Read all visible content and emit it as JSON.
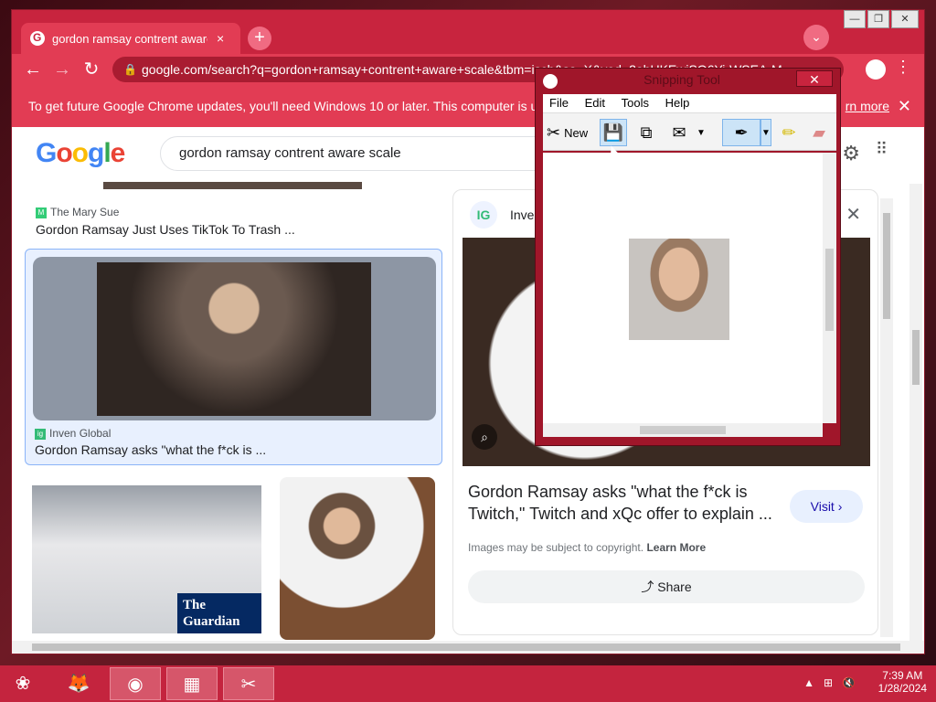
{
  "browser": {
    "tab_title": "gordon ramsay contrent aware sc",
    "tab_close": "×",
    "new_tab": "+",
    "url": "google.com/search?q=gordon+ramsay+contrent+aware+scale&tbm=isch&sa=X&ved=2ahUKEwjSQ6Yi-WSEA-M...",
    "infobar_text": "To get future Google Chrome updates, you'll need Windows 10 or later. This computer is using W",
    "infobar_link": "rn more",
    "infobar_close": "✕"
  },
  "google": {
    "search_value": "gordon ramsay contrent aware scale"
  },
  "results": {
    "r1_source": "The Mary Sue",
    "r1_title": "Gordon Ramsay Just Uses TikTok To Trash ...",
    "r2_source": "Inven Global",
    "r2_title": "Gordon Ramsay asks \"what the f*ck is ...",
    "guardian_label": "The Guardian"
  },
  "panel": {
    "logo": "IG",
    "source": "Inven",
    "title": "Gordon Ramsay asks \"what the f*ck is Twitch,\" Twitch and xQc offer to explain ...",
    "visit": "Visit ›",
    "copyright": "Images may be subject to copyright.",
    "learn_more": "Learn More",
    "share": "Share"
  },
  "snipping_tool": {
    "title": "Snipping Tool",
    "close": "✕",
    "menu": [
      "File",
      "Edit",
      "Tools",
      "Help"
    ],
    "new_label": "New"
  },
  "taskbar": {
    "time": "7:39 AM",
    "date": "1/28/2024"
  },
  "colors": {
    "accent": "#c8243e",
    "google_blue": "#4285f4"
  }
}
